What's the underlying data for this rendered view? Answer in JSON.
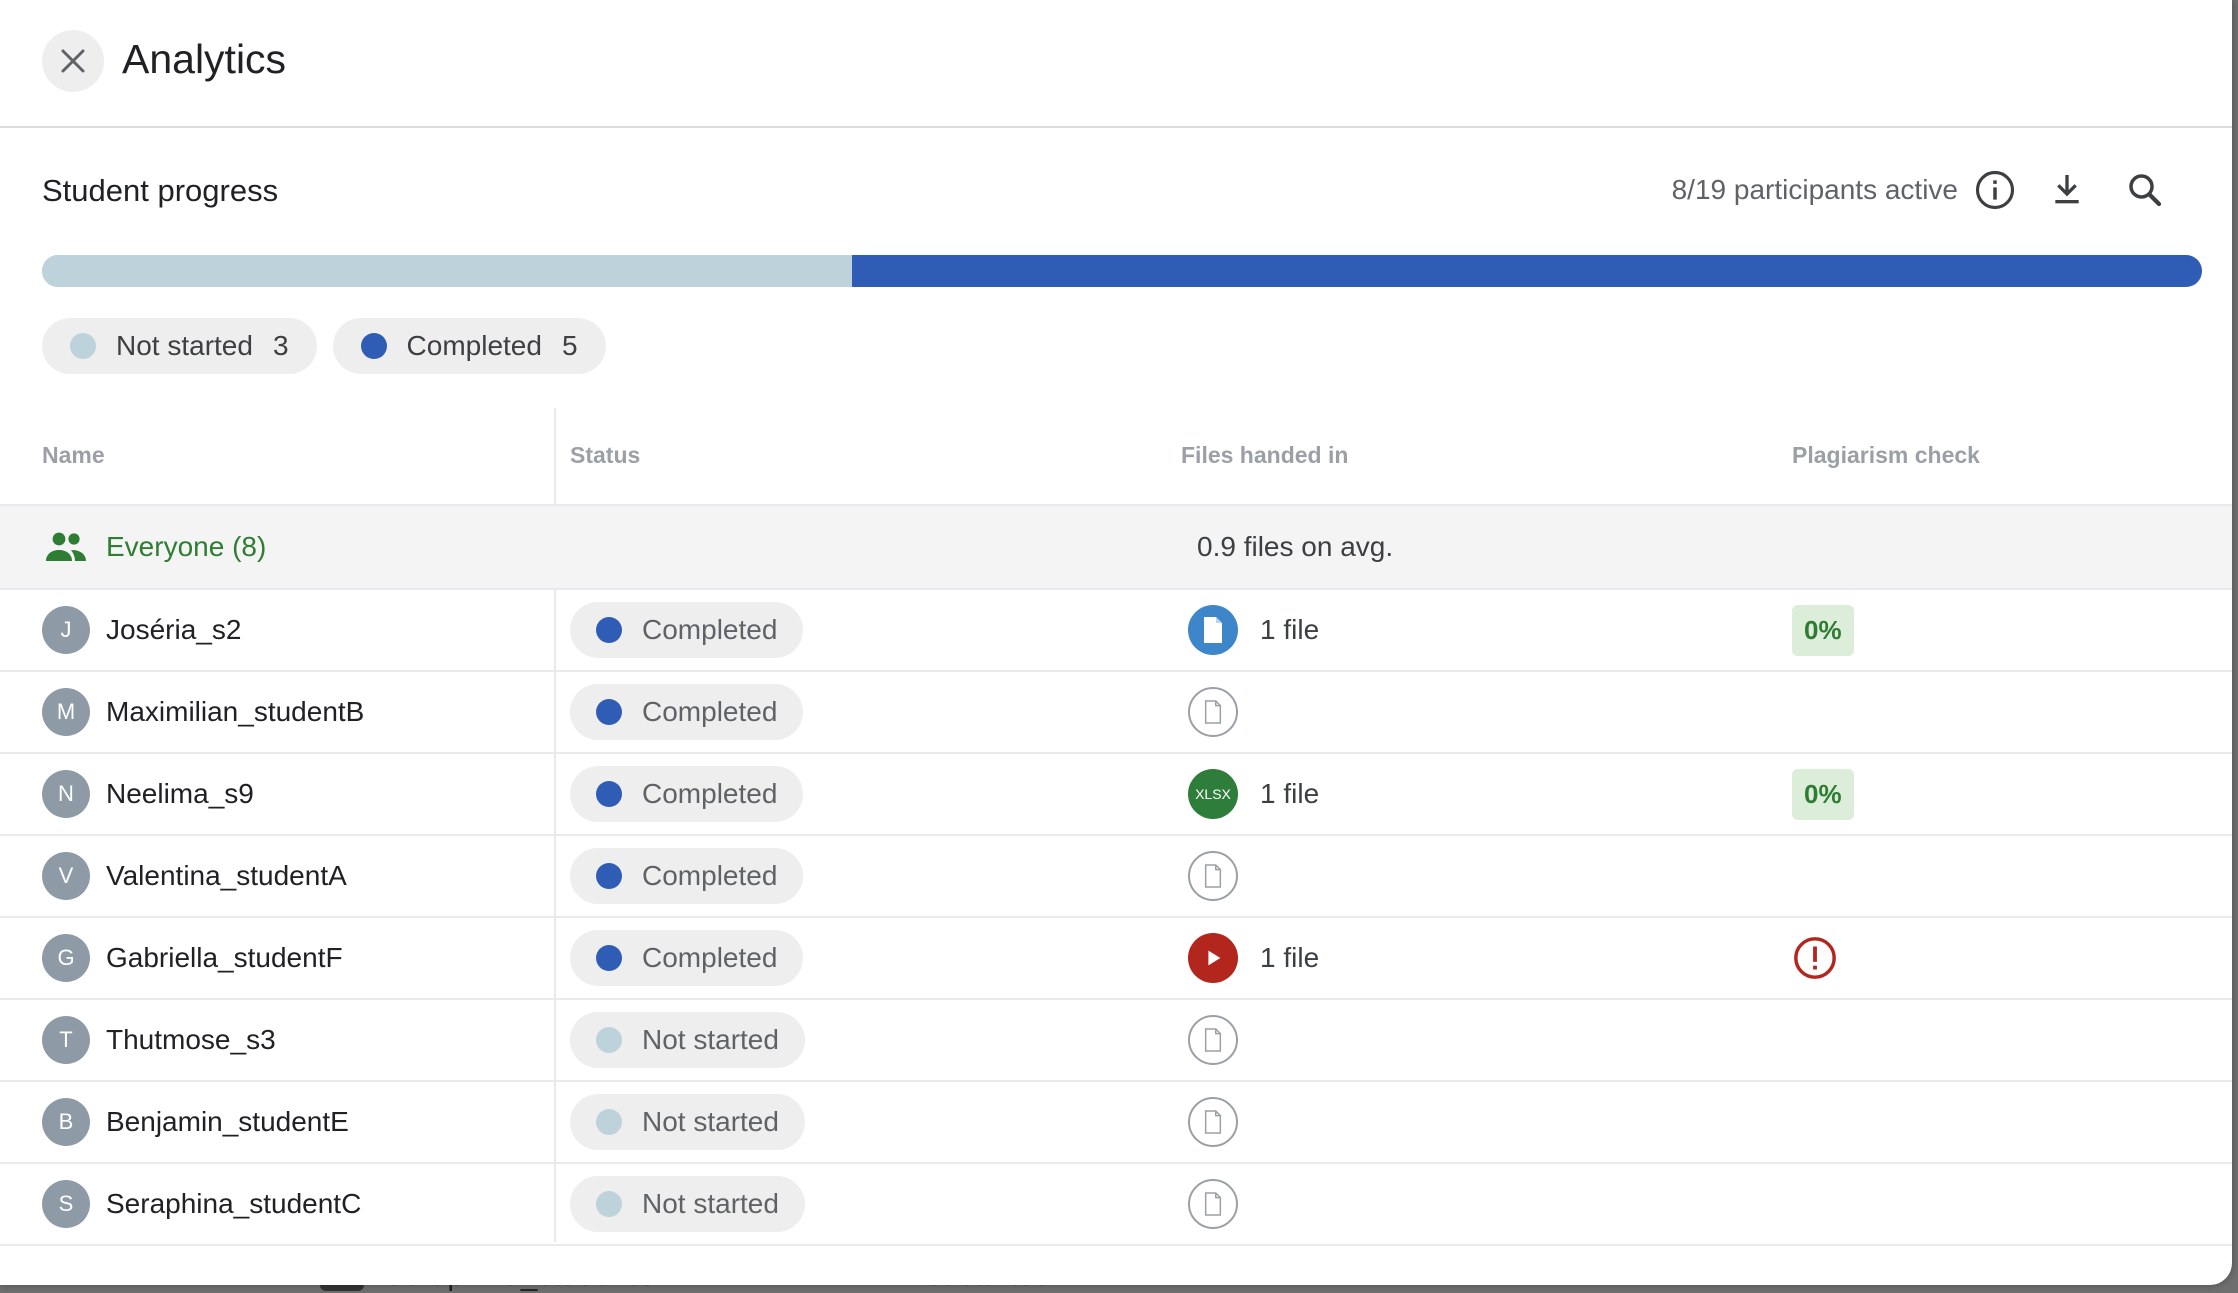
{
  "header": {
    "title": "Analytics"
  },
  "progress": {
    "section_title": "Student progress",
    "active_text": "8/19 participants active",
    "completed_fraction": 0.625,
    "not_started_fraction": 0.375,
    "chips": [
      {
        "label": "Not started",
        "count": "3"
      },
      {
        "label": "Completed",
        "count": "5"
      }
    ]
  },
  "table": {
    "headers": {
      "name": "Name",
      "status": "Status",
      "files": "Files handed in",
      "plagiarism": "Plagiarism check"
    },
    "everyone": {
      "label": "Everyone (8)",
      "avg": "0.9 files on avg."
    },
    "rows": [
      {
        "initial": "J",
        "name": "Joséria_s2",
        "status": "Completed",
        "file_type": "doc",
        "file_text": "1 file",
        "plagiarism": "0%"
      },
      {
        "initial": "M",
        "name": "Maximilian_studentB",
        "status": "Completed",
        "file_type": "none",
        "file_text": "",
        "plagiarism": ""
      },
      {
        "initial": "N",
        "name": "Neelima_s9",
        "status": "Completed",
        "file_type": "xlsx",
        "file_label": "XLSX",
        "file_text": "1 file",
        "plagiarism": "0%"
      },
      {
        "initial": "V",
        "name": "Valentina_studentA",
        "status": "Completed",
        "file_type": "none",
        "file_text": "",
        "plagiarism": ""
      },
      {
        "initial": "G",
        "name": "Gabriella_studentF",
        "status": "Completed",
        "file_type": "video",
        "file_text": "1 file",
        "plagiarism": "alert"
      },
      {
        "initial": "T",
        "name": "Thutmose_s3",
        "status": "Not started",
        "file_type": "none",
        "file_text": "",
        "plagiarism": ""
      },
      {
        "initial": "B",
        "name": "Benjamin_studentE",
        "status": "Not started",
        "file_type": "none",
        "file_text": "",
        "plagiarism": ""
      },
      {
        "initial": "S",
        "name": "Seraphina_studentC",
        "status": "Not started",
        "file_type": "none",
        "file_text": "",
        "plagiarism": ""
      }
    ]
  },
  "background": {
    "peek_name": "Seraphina_studentC",
    "peek_status": "Not started"
  },
  "colors": {
    "completed": "#2f5db6",
    "not_started": "#bdd2da",
    "accent_green": "#2e7d32",
    "alert_red": "#b3261e"
  },
  "icons": {
    "close": "close-icon",
    "info": "info-icon",
    "download": "download-icon",
    "search": "search-icon",
    "group": "group-icon"
  }
}
